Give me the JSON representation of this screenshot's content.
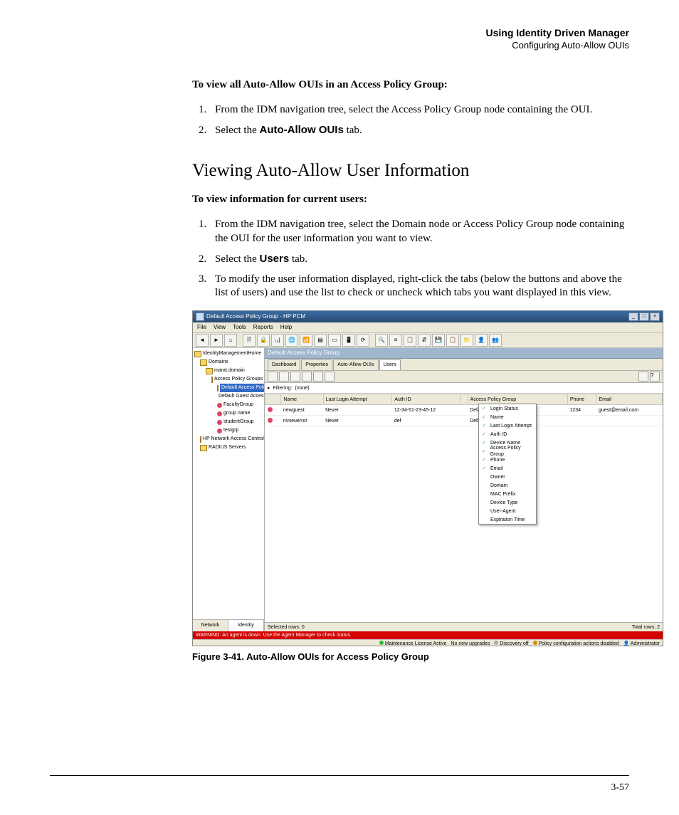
{
  "header": {
    "title": "Using Identity Driven Manager",
    "subtitle": "Configuring Auto-Allow OUIs"
  },
  "section1": {
    "lead": "To view all Auto-Allow OUIs in an Access Policy Group:",
    "steps": [
      "From the IDM navigation tree, select the Access Policy Group node containing the OUI.",
      {
        "pre": "Select the ",
        "bold": "Auto-Allow OUIs",
        "post": " tab."
      }
    ]
  },
  "section2": {
    "heading": "Viewing Auto-Allow User Information",
    "lead": "To view information for current users:",
    "steps": [
      "From the IDM navigation tree, select the Domain node or Access Policy Group node containing the OUI for the user information you want to view.",
      {
        "pre": "Select the ",
        "bold": "Users",
        "post": " tab."
      },
      "To modify the user information displayed, right-click the tabs (below the buttons and above the list of users) and use the list to check or uncheck which tabs you want displayed in this view."
    ]
  },
  "figure": {
    "caption": "Figure 3-41. Auto-Allow OUIs for Access Policy Group"
  },
  "app": {
    "title": "Default Access Policy Group - HP PCM",
    "menus": [
      "File",
      "View",
      "Tools",
      "Reports",
      "Help"
    ],
    "tree": [
      {
        "lvl": 0,
        "icon": "fld",
        "label": "IdentityManagementHome"
      },
      {
        "lvl": 1,
        "icon": "fld",
        "label": "Domains"
      },
      {
        "lvl": 2,
        "icon": "fld",
        "label": "marat.domain"
      },
      {
        "lvl": 3,
        "icon": "fld",
        "label": "Access Policy Groups"
      },
      {
        "lvl": 4,
        "icon": "fld",
        "label": "Default Access Policy",
        "sel": true
      },
      {
        "lvl": 4,
        "icon": "usr",
        "label": "Default Guest Access Po"
      },
      {
        "lvl": 4,
        "icon": "usr",
        "label": "FacultyGroup"
      },
      {
        "lvl": 4,
        "icon": "usr",
        "label": "group name"
      },
      {
        "lvl": 4,
        "icon": "usr",
        "label": "studentGroup"
      },
      {
        "lvl": 4,
        "icon": "usr",
        "label": "testgrp"
      },
      {
        "lvl": 1,
        "icon": "fld",
        "label": "HP Network Access Control"
      },
      {
        "lvl": 1,
        "icon": "fld",
        "label": "RADIUS Servers"
      }
    ],
    "navtabs": [
      "Network",
      "Identity"
    ],
    "navtab_active": 1,
    "maintitle": "Default Access Policy Group",
    "tabs": [
      "Dashboard",
      "Properties",
      "Auto-Allow OUIs",
      "Users"
    ],
    "tab_active": 3,
    "filter_label": "Filtering:",
    "filter_value": "(none)",
    "columns": [
      "",
      "Name",
      "Last Login Attempt",
      "Auth ID",
      "",
      "Access Policy Group",
      "Phone",
      "Email"
    ],
    "rows": [
      {
        "name": "newguest",
        "last": "Never",
        "auth": "12-34-51-23-45-12",
        "apg": "Default Access Policy Group",
        "phone": "1234",
        "email": "guest@email.com"
      },
      {
        "name": "nvneuerror",
        "last": "Never",
        "auth": "def",
        "apg": "Default Access Policy Group",
        "phone": "",
        "email": ""
      }
    ],
    "context_menu": [
      {
        "chk": true,
        "label": "Login Status"
      },
      {
        "chk": true,
        "label": "Name"
      },
      {
        "chk": true,
        "label": "Last Login Attempt"
      },
      {
        "chk": true,
        "label": "Auth ID"
      },
      {
        "chk": true,
        "label": "Device Name"
      },
      {
        "chk": true,
        "label": "Access Policy Group"
      },
      {
        "chk": true,
        "label": "Phone"
      },
      {
        "chk": true,
        "label": "Email"
      },
      {
        "chk": false,
        "label": "Owner"
      },
      {
        "chk": false,
        "label": "Domain"
      },
      {
        "chk": false,
        "label": "MAC Prefix"
      },
      {
        "chk": false,
        "label": "Device Type"
      },
      {
        "chk": false,
        "label": "User-Agent"
      },
      {
        "chk": false,
        "label": "Expiration Time"
      }
    ],
    "status": {
      "selected": "Selected rows: 0",
      "total": "Total rows: 2"
    },
    "warning": "WARNING: An agent is down. Use the Agent Manager to check status.",
    "footer": [
      "Maintenance License Active",
      "No new upgrades",
      "Discovery off",
      "Policy configuration actions disabled",
      "Administrator"
    ]
  },
  "pagenum": "3-57"
}
